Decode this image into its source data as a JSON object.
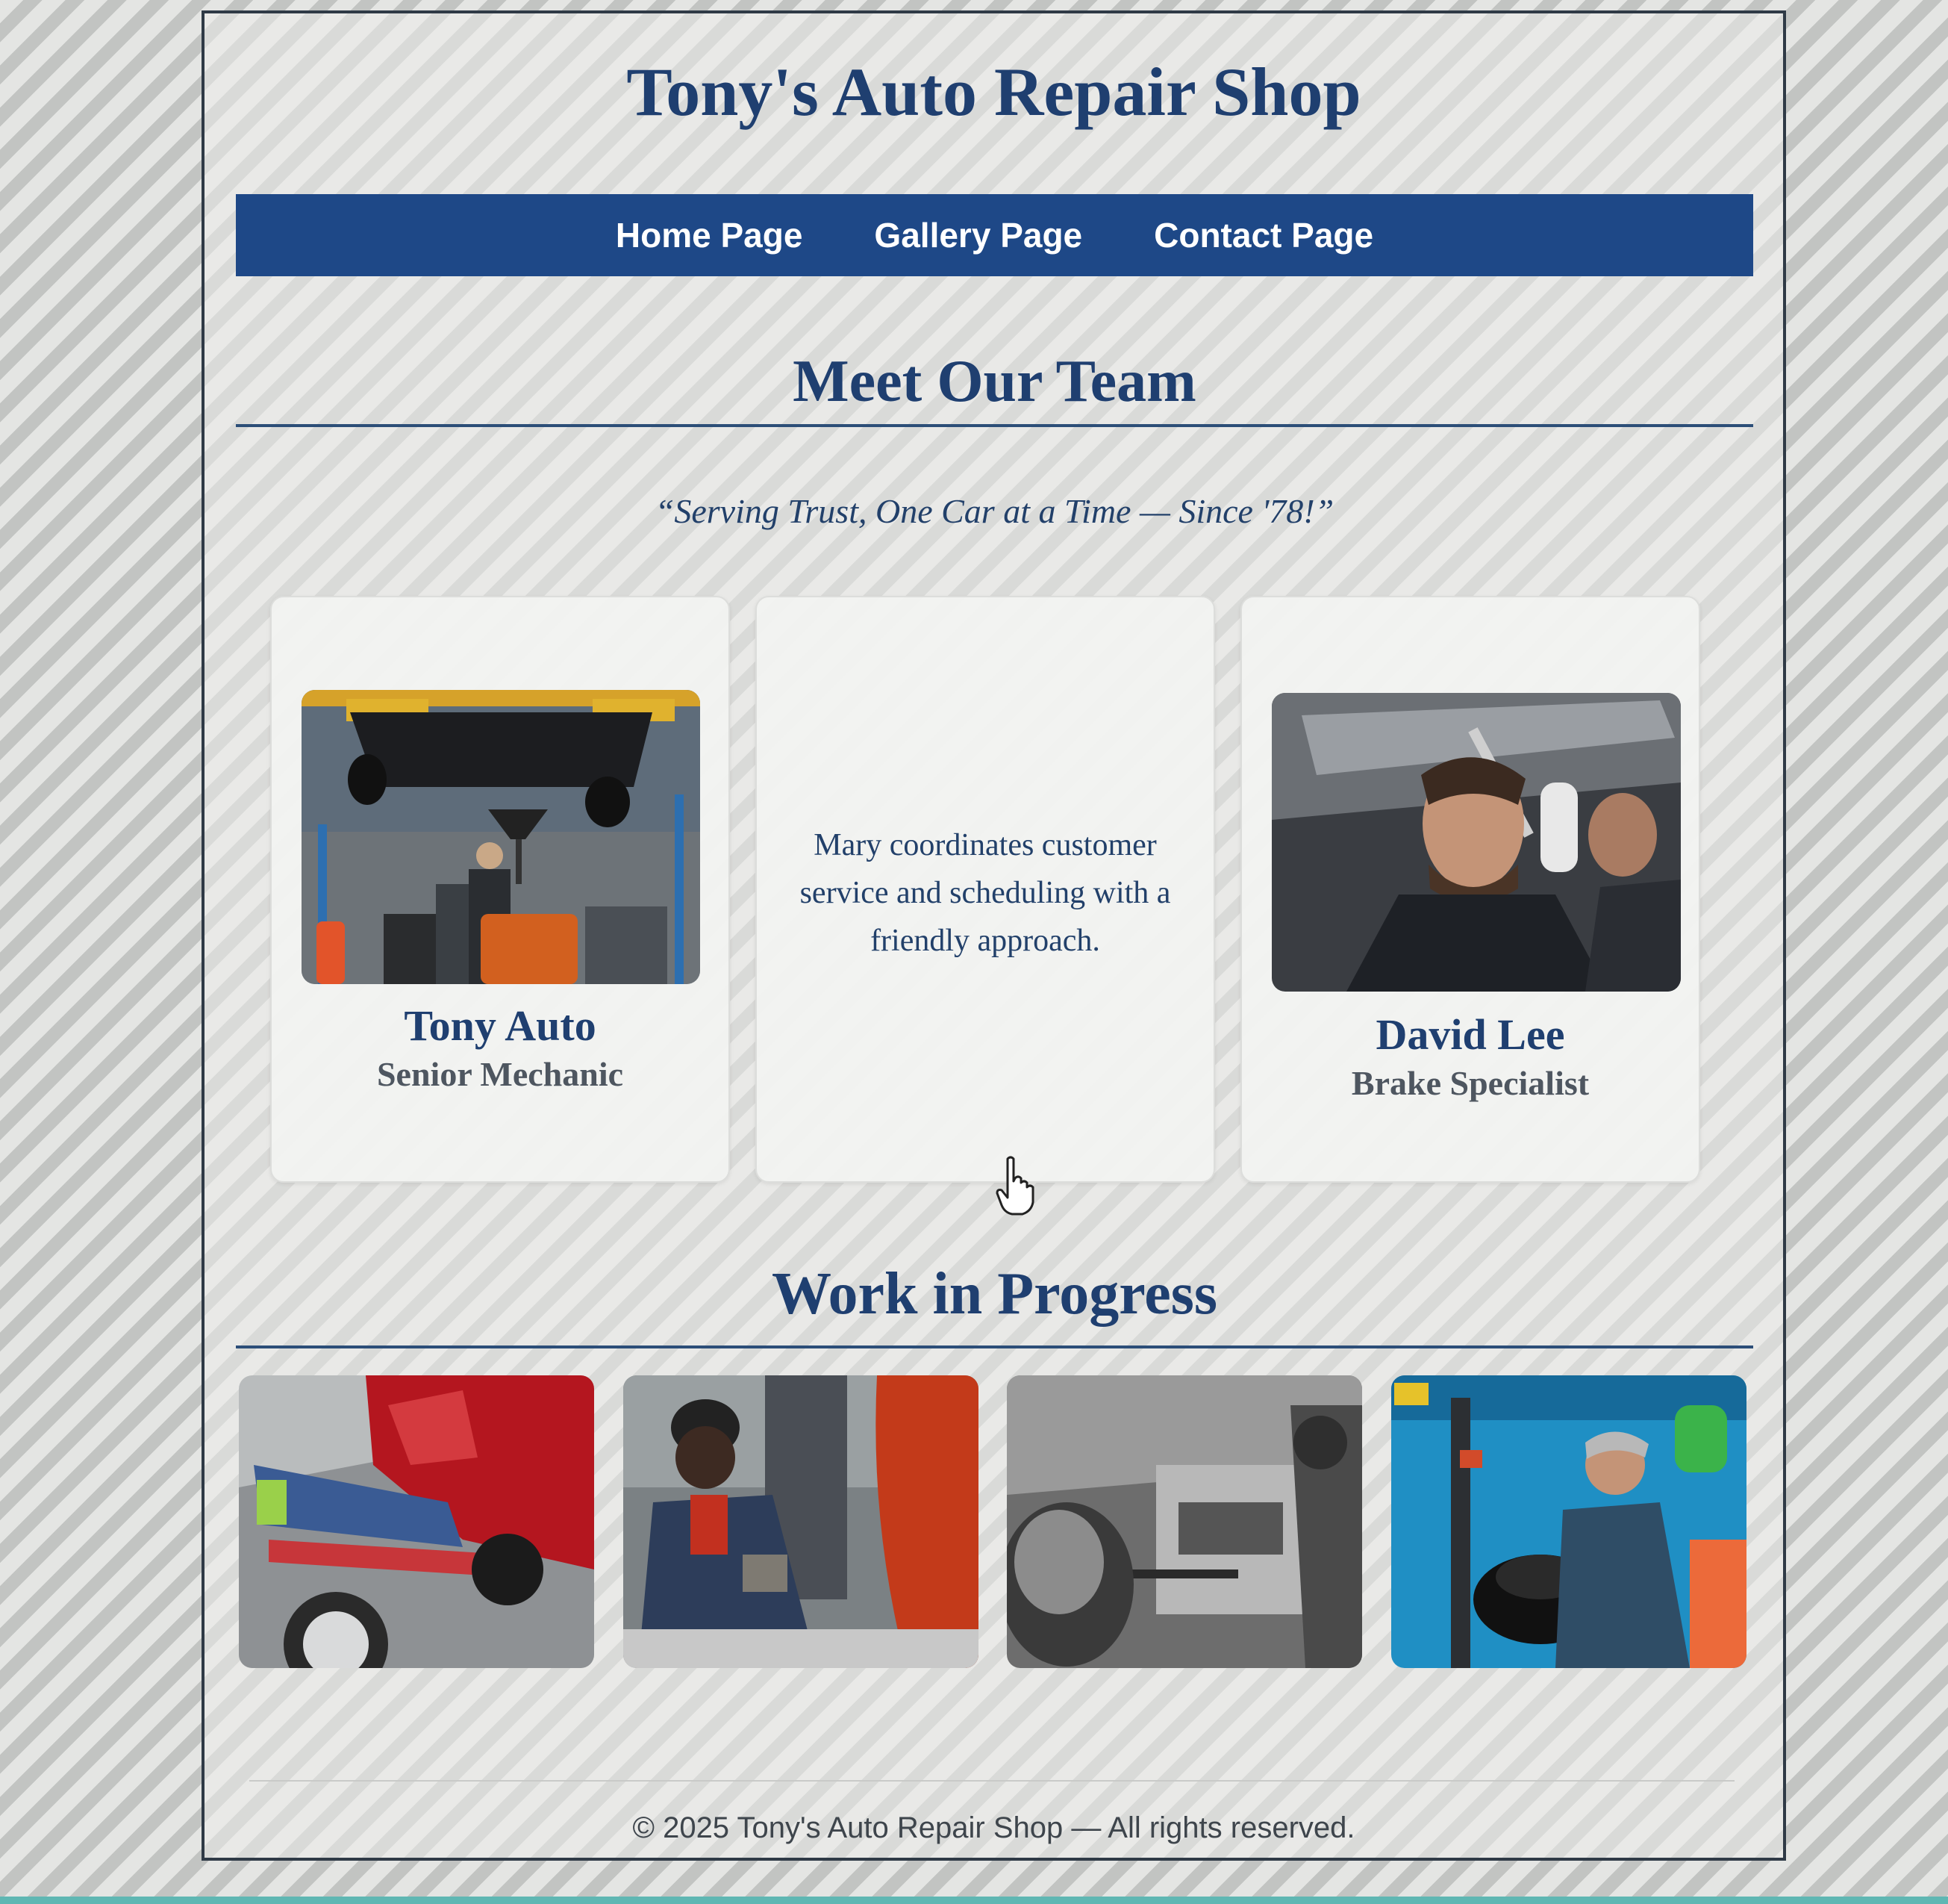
{
  "header": {
    "title": "Tony's Auto Repair Shop"
  },
  "nav": {
    "items": [
      "Home Page",
      "Gallery Page",
      "Contact Page"
    ]
  },
  "team": {
    "heading": "Meet Our Team",
    "tagline": "“Serving Trust, One Car at a Time — Since '78!”",
    "members": [
      {
        "name": "Tony Auto",
        "role": "Senior Mechanic"
      },
      {
        "bio": "Mary coordinates customer service and scheduling with a friendly approach."
      },
      {
        "name": "David Lee",
        "role": "Brake Specialist"
      }
    ]
  },
  "work": {
    "heading": "Work in Progress"
  },
  "footer": {
    "text": "© 2025 Tony's Auto Repair Shop — All rights reserved."
  },
  "colors": {
    "brand_navy": "#1e4887",
    "heading_text": "#1f3f70",
    "footer_accent": "#5fb7b3"
  }
}
